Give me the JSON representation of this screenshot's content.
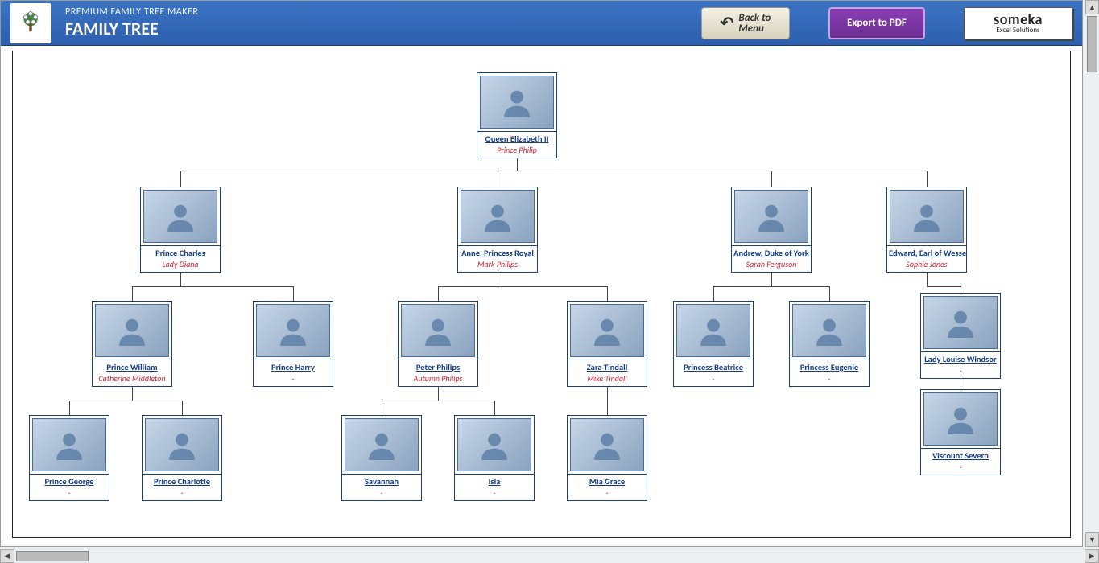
{
  "header": {
    "subtitle": "PREMIUM FAMILY TREE MAKER",
    "title": "FAMILY TREE",
    "back_to_menu_line1": "Back to",
    "back_to_menu_line2": "Menu",
    "export_label": "Export to PDF",
    "brand_name": "someka",
    "brand_tag": "Excel Solutions"
  },
  "people": {
    "root": {
      "name": "Queen Elizabeth II",
      "spouse": "Prince Philip"
    },
    "charles": {
      "name": "Prince Charles",
      "spouse": "Lady Diana"
    },
    "anne": {
      "name": "Anne, Princess Royal",
      "spouse": "Mark Philips"
    },
    "andrew": {
      "name": "Andrew, Duke of York",
      "spouse": "Sarah Ferguson"
    },
    "edward": {
      "name": "Edward, Earl of Wessex",
      "spouse": "Sophie Jones"
    },
    "william": {
      "name": "Prince William",
      "spouse": "Catherine Middleton"
    },
    "harry": {
      "name": "Prince Harry",
      "spouse": "-"
    },
    "peter": {
      "name": "Peter Philips",
      "spouse": "Autumn Philips"
    },
    "zara": {
      "name": "Zara Tindall",
      "spouse": "Mike Tindall"
    },
    "beatrice": {
      "name": "Princess Beatrice",
      "spouse": "-"
    },
    "eugenie": {
      "name": "Princess Eugenie",
      "spouse": "-"
    },
    "louise": {
      "name": "Lady Louise Windsor",
      "spouse": "-"
    },
    "severn": {
      "name": "Viscount Severn",
      "spouse": "-"
    },
    "george": {
      "name": "Prince George",
      "spouse": "-"
    },
    "charlotte": {
      "name": "Prince Charlotte",
      "spouse": "-"
    },
    "savannah": {
      "name": "Savannah",
      "spouse": "-"
    },
    "isla": {
      "name": "Isla",
      "spouse": "-"
    },
    "mia": {
      "name": "Mia Grace",
      "spouse": "-"
    }
  }
}
